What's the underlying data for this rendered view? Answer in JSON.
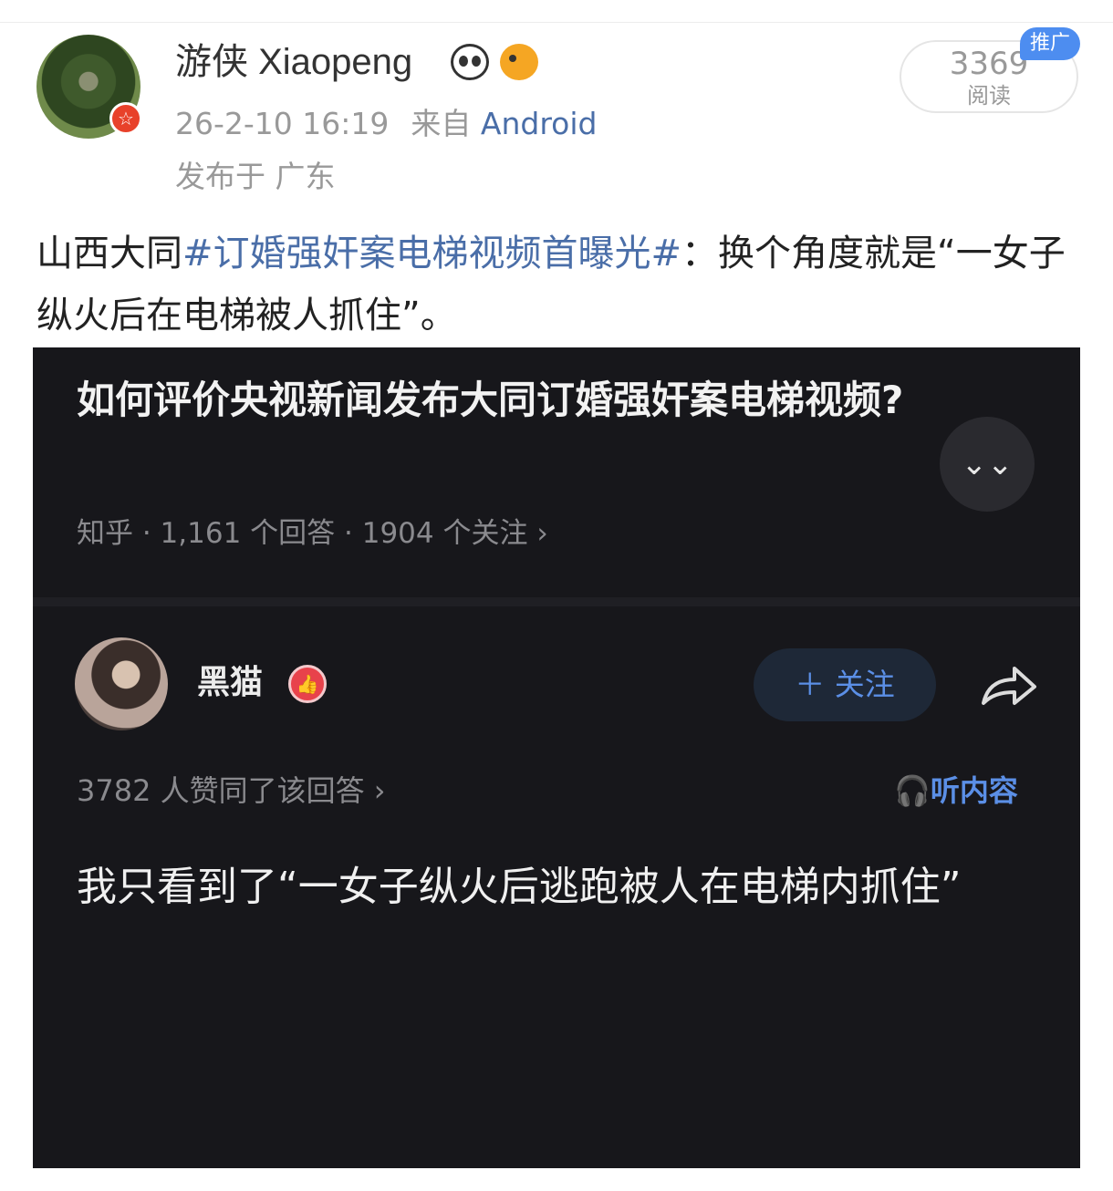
{
  "post": {
    "author": {
      "name": "游侠 Xiaopeng",
      "emojis": [
        "panda-icon",
        "pufferfish-icon"
      ]
    },
    "timestamp": "26-2-10 16:19",
    "source_prefix": "来自",
    "source": "Android",
    "location": "发布于 广东",
    "reads": {
      "count": "3369",
      "label": "阅读"
    },
    "promo_tag": "推广",
    "text": {
      "prefix": "山西大同",
      "hashtag": "#订婚强奸案电梯视频首曝光#",
      "suffix": "：换个角度就是“一女子纵火后在电梯被人抓住”。"
    }
  },
  "embedded": {
    "question_title": "如何评价央视新闻发布大同订婚强奸案电梯视频?",
    "question_meta": "知乎 · 1,161 个回答 · 1904 个关注 ›",
    "answer": {
      "author": "黑猫",
      "follow_label": "＋ 关注",
      "agree_text": "3782 人赞同了该回答 ›",
      "listen_label": "听内容",
      "body": "我只看到了“一女子纵火后逃跑被人在电梯内抓住”"
    }
  },
  "colors": {
    "link": "#4a6ea8",
    "dark_bg": "#17171b",
    "accent_blue": "#5b8fe6"
  }
}
